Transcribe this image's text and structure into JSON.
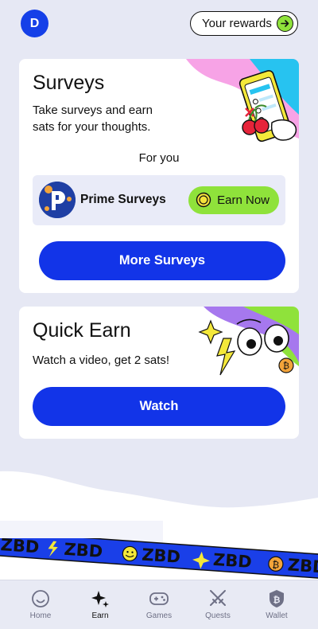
{
  "header": {
    "avatar_letter": "D",
    "rewards_label": "Your rewards"
  },
  "surveys": {
    "title": "Surveys",
    "description_line1": "Take surveys and earn",
    "description_line2": "sats for your thoughts.",
    "for_you_label": "For you",
    "provider_name": "Prime Surveys",
    "earn_now_label": "Earn Now",
    "more_button": "More Surveys"
  },
  "quick_earn": {
    "title": "Quick Earn",
    "description": "Watch a video, get 2 sats!",
    "watch_button": "Watch"
  },
  "banner": {
    "text": "ZBD"
  },
  "tabs": [
    {
      "label": "Home",
      "icon": "smiley-icon"
    },
    {
      "label": "Earn",
      "icon": "sparkle-icon",
      "active": true
    },
    {
      "label": "Games",
      "icon": "gamepad-icon"
    },
    {
      "label": "Quests",
      "icon": "crossed-swords-icon"
    },
    {
      "label": "Wallet",
      "icon": "bitcoin-shield-icon"
    }
  ],
  "colors": {
    "brand_blue": "#1234e8",
    "accent_green": "#8fe23b",
    "background": "#e6e8f4"
  }
}
